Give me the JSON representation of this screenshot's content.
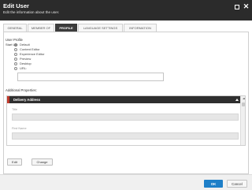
{
  "window": {
    "title": "Edit User",
    "subtitle": "Edit the information about the user."
  },
  "tabs": [
    {
      "label": "GENERAL",
      "active": false
    },
    {
      "label": "MEMBER OF",
      "active": false
    },
    {
      "label": "PROFILE",
      "active": true
    },
    {
      "label": "LANGUAGE SETTINGS",
      "active": false
    },
    {
      "label": "INFORMATION",
      "active": false
    }
  ],
  "profile": {
    "section_title": "User Profile",
    "start_url_label": "Start Url:",
    "start_url_options": [
      {
        "label": "Default",
        "checked": true
      },
      {
        "label": "Content Editor",
        "checked": false
      },
      {
        "label": "Experience Editor",
        "checked": false
      },
      {
        "label": "Preview",
        "checked": false
      },
      {
        "label": "Desktop",
        "checked": false
      },
      {
        "label": "URL:",
        "checked": false
      }
    ],
    "url_value": "",
    "additional_properties_title": "Additional Properties:",
    "delivery_section_title": "Delivery Address",
    "fields": [
      {
        "label": "Title",
        "value": ""
      },
      {
        "label": "First Name",
        "value": ""
      }
    ],
    "edit_button": "Edit",
    "change_button": "Change"
  },
  "footer": {
    "ok_label": "OK",
    "cancel_label": "Cancel"
  },
  "colors": {
    "titlebar": "#2b2b2b",
    "active_tab": "#3c3c3c",
    "section_accent": "#c0392b",
    "ok_button": "#1e7fc8"
  }
}
